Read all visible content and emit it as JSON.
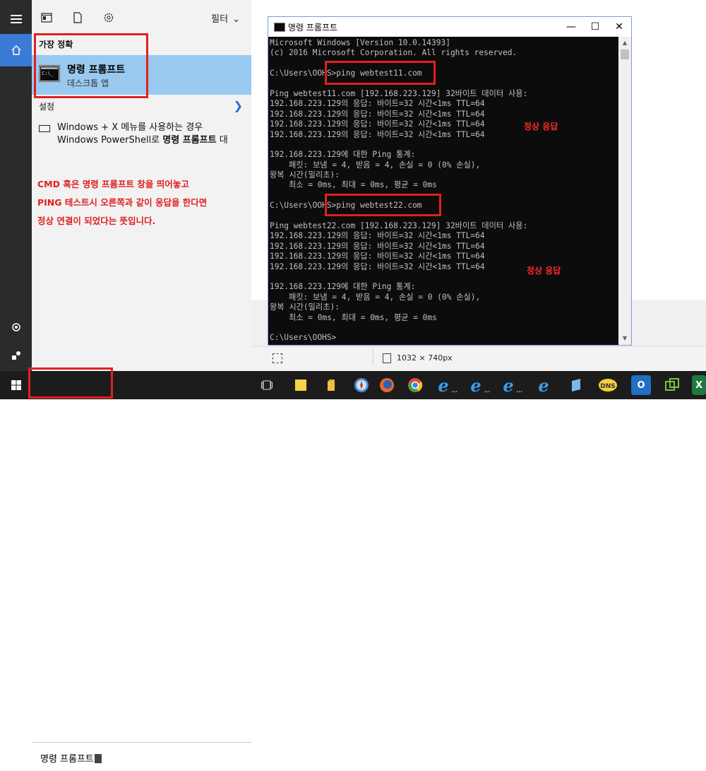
{
  "start_menu": {
    "filter_label": "필터",
    "best_match_label": "가장 정확",
    "best_match": {
      "title": "명령 프롬프트",
      "subtitle": "데스크톱 앱",
      "icon": "cmd-icon"
    },
    "settings_label": "설정",
    "setting_item_line1": "Windows + X 메뉴를 사용하는 경우",
    "setting_item_line2_prefix": "Windows PowerShell로 ",
    "setting_item_line2_bold": "명령 프롬프트",
    "setting_item_line2_suffix": " 대",
    "search_text": "명령 프롬프트",
    "note_lines": [
      "CMD 혹은 명령 프롬프트 창을 띄어놓고",
      "PING 테스트시 오른쪽과 같이 응답을 한다면",
      "정상 연결이 되었다는 뜻입니다."
    ]
  },
  "console": {
    "title": "명령 프롬프트",
    "lines": [
      "Microsoft Windows [Version 10.0.14393]",
      "(c) 2016 Microsoft Corporation. All rights reserved.",
      "",
      "C:\\Users\\OOHS>ping webtest11.com",
      "",
      "Ping webtest11.com [192.168.223.129] 32바이트 데이터 사용:",
      "192.168.223.129의 응답: 바이트=32 시간<1ms TTL=64",
      "192.168.223.129의 응답: 바이트=32 시간<1ms TTL=64",
      "192.168.223.129의 응답: 바이트=32 시간<1ms TTL=64",
      "192.168.223.129의 응답: 바이트=32 시간<1ms TTL=64",
      "",
      "192.168.223.129에 대한 Ping 통계:",
      "    패킷: 보냄 = 4, 받음 = 4, 손실 = 0 (0% 손실),",
      "왕복 시간(밀리초):",
      "    최소 = 0ms, 최대 = 0ms, 평균 = 0ms",
      "",
      "C:\\Users\\OOHS>ping webtest22.com",
      "",
      "Ping webtest22.com [192.168.223.129] 32바이트 데이터 사용:",
      "192.168.223.129의 응답: 바이트=32 시간<1ms TTL=64",
      "192.168.223.129의 응답: 바이트=32 시간<1ms TTL=64",
      "192.168.223.129의 응답: 바이트=32 시간<1ms TTL=64",
      "192.168.223.129의 응답: 바이트=32 시간<1ms TTL=64",
      "",
      "192.168.223.129에 대한 Ping 통계:",
      "    패킷: 보냄 = 4, 받음 = 4, 손실 = 0 (0% 손실),",
      "왕복 시간(밀리초):",
      "    최소 = 0ms, 최대 = 0ms, 평균 = 0ms",
      "",
      "C:\\Users\\OOHS>"
    ],
    "tag1": "정상 응답",
    "tag2": "정상 응답"
  },
  "viewer": {
    "dimensions": "1032 × 740px"
  },
  "taskbar": {
    "apps": [
      "task-view-icon",
      "sticky-notes-icon",
      "file-explorer-icon",
      "safari-icon",
      "firefox-icon",
      "chrome-icon",
      "ie-icon",
      "ie-icon",
      "ie-icon",
      "ie-icon",
      "notepad-icon",
      "dns-icon",
      "outlook-icon",
      "vmware-icon",
      "excel-icon"
    ],
    "dns_label": "DNS",
    "outlook_label": "O",
    "excel_label": "X"
  },
  "colors": {
    "accent": "#3a7bd5",
    "highlight": "#99c9ef",
    "annotation": "#e02020",
    "console_bg": "#0c0c0c"
  }
}
